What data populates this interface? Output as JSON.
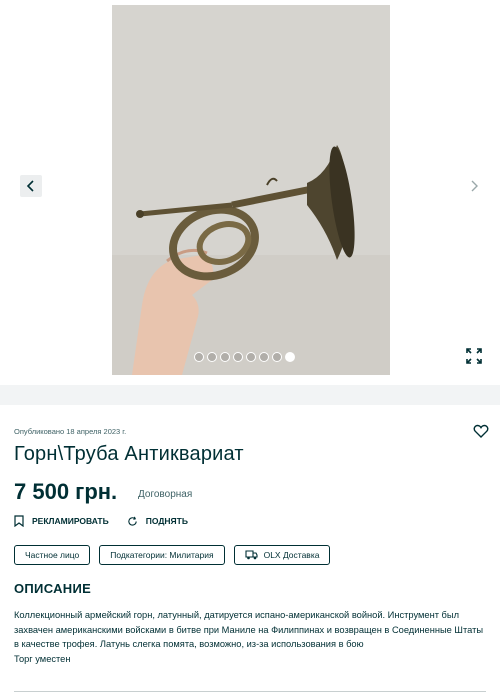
{
  "gallery": {
    "photo_count": 8,
    "active_index": 7,
    "icons": {
      "prev": "chevron-left-icon",
      "next": "chevron-right-icon",
      "expand": "expand-icon"
    }
  },
  "ad": {
    "published": "Опубликовано 18 апреля 2023 г.",
    "title": "Горн\\Труба Антиквариат",
    "price": "7 500 грн.",
    "negotiable": "Договорная",
    "favorite_icon": "heart-icon"
  },
  "actions": {
    "promote": "РЕКЛАМИРОВАТЬ",
    "raise": "ПОДНЯТЬ"
  },
  "tags": {
    "private": "Частное лицо",
    "subcategory": "Подкатегории: Милитария",
    "delivery": "OLX Доставка"
  },
  "description": {
    "heading": "ОПИСАНИЕ",
    "text": "Коллекционный армейский горн, латунный, датируется испано-американской войной. Инструмент был захвачен американскими войсками в битве при Маниле на Филиппинах и возвращен в Соединенные Штаты в качестве трофея. Латунь слегка помята, возможно, из-за использования в бою",
    "text2": "Торг уместен"
  },
  "colors": {
    "primary": "#002f34",
    "muted": "#406367",
    "background": "#f2f4f5"
  }
}
